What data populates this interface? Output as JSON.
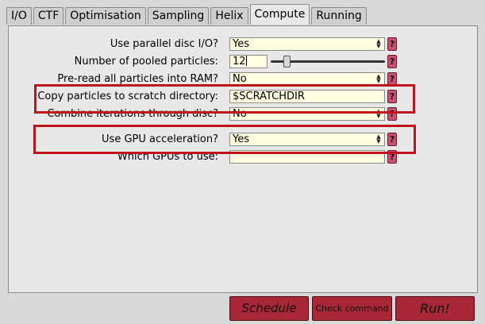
{
  "tabs": [
    {
      "label": "I/O"
    },
    {
      "label": "CTF"
    },
    {
      "label": "Optimisation"
    },
    {
      "label": "Sampling"
    },
    {
      "label": "Helix"
    },
    {
      "label": "Compute"
    },
    {
      "label": "Running"
    }
  ],
  "active_tab": "Compute",
  "form": {
    "parallel_io": {
      "label": "Use parallel disc I/O?",
      "value": "Yes"
    },
    "pooled": {
      "label": "Number of pooled particles:",
      "value": "12",
      "slider_fraction": 0.12
    },
    "preread": {
      "label": "Pre-read all particles into RAM?",
      "value": "No"
    },
    "scratch": {
      "label": "Copy particles to scratch directory:",
      "value": "$SCRATCHDIR"
    },
    "combine": {
      "label": "Combine iterations through disc?",
      "value": "No"
    },
    "gpu": {
      "label": "Use GPU acceleration?",
      "value": "Yes"
    },
    "which_gpus": {
      "label": "Which GPUs to use:",
      "value": ""
    },
    "help_label": "?"
  },
  "buttons": {
    "schedule": "Schedule",
    "check": "Check command",
    "run": "Run!"
  },
  "colors": {
    "highlight": "#c0141c",
    "field_bg": "#fefee0",
    "button": "#a82838",
    "help": "#c85070"
  }
}
